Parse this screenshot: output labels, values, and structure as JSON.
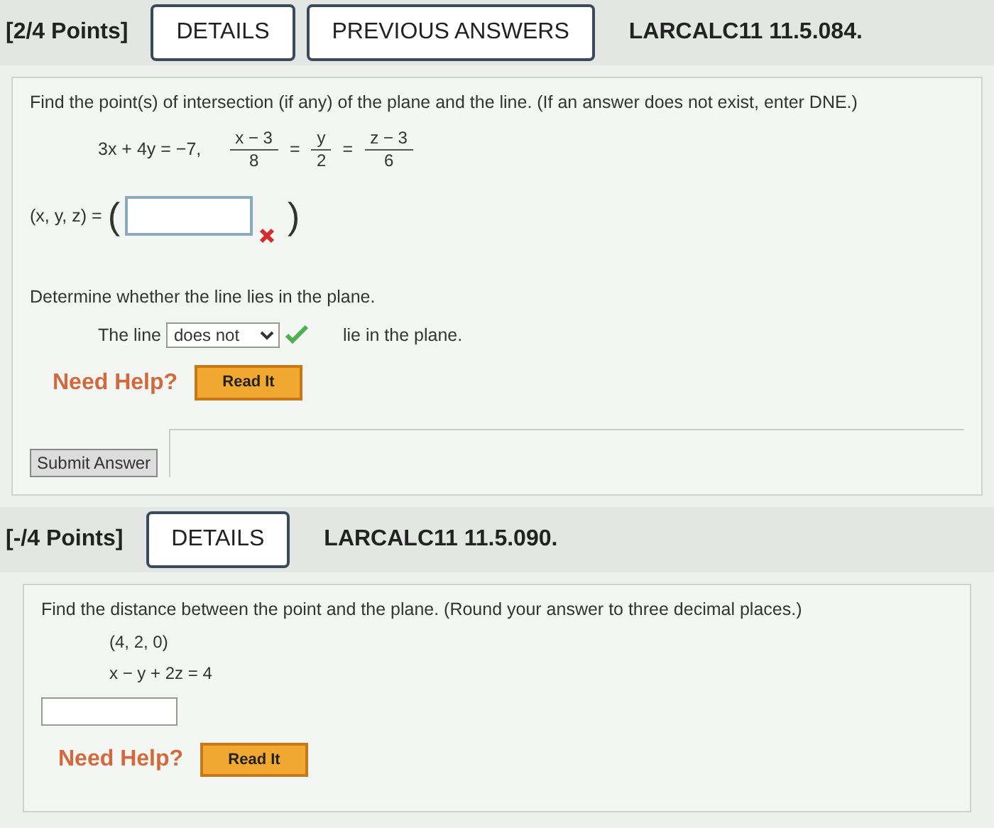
{
  "question_1": {
    "points": "[2/4 Points]",
    "buttons": [
      "DETAILS",
      "PREVIOUS ANSWERS"
    ],
    "code": "LARCALC11 11.5.084.",
    "prompt": "Find the point(s) of intersection (if any) of the plane and the line. (If an answer does not exist, enter DNE.)",
    "plane": "3x + 4y = −7,",
    "fractions": [
      {
        "numerator": "x − 3",
        "denominator": "8"
      },
      {
        "numerator": "y",
        "denominator": "2"
      },
      {
        "numerator": "z − 3",
        "denominator": "6"
      }
    ],
    "equals": "=",
    "answer": {
      "label": "(x, y, z) =",
      "open": "(",
      "close": ")",
      "correct": false
    },
    "part_b": {
      "prompt": "Determine whether the line lies in the plane.",
      "before": "The line",
      "select_value": "does not",
      "correct": true,
      "after": "lie in the plane."
    },
    "help": {
      "label": "Need Help?",
      "button": "Read It"
    },
    "submit": "Submit Answer"
  },
  "question_2": {
    "points": "[-/4 Points]",
    "buttons": [
      "DETAILS"
    ],
    "code": "LARCALC11 11.5.090.",
    "prompt": "Find the distance between the point and the plane. (Round your answer to three decimal places.)",
    "math_lines": [
      "(4, 2, 0)",
      "x − y + 2z = 4"
    ],
    "help": {
      "label": "Need Help?",
      "button": "Read It"
    }
  }
}
